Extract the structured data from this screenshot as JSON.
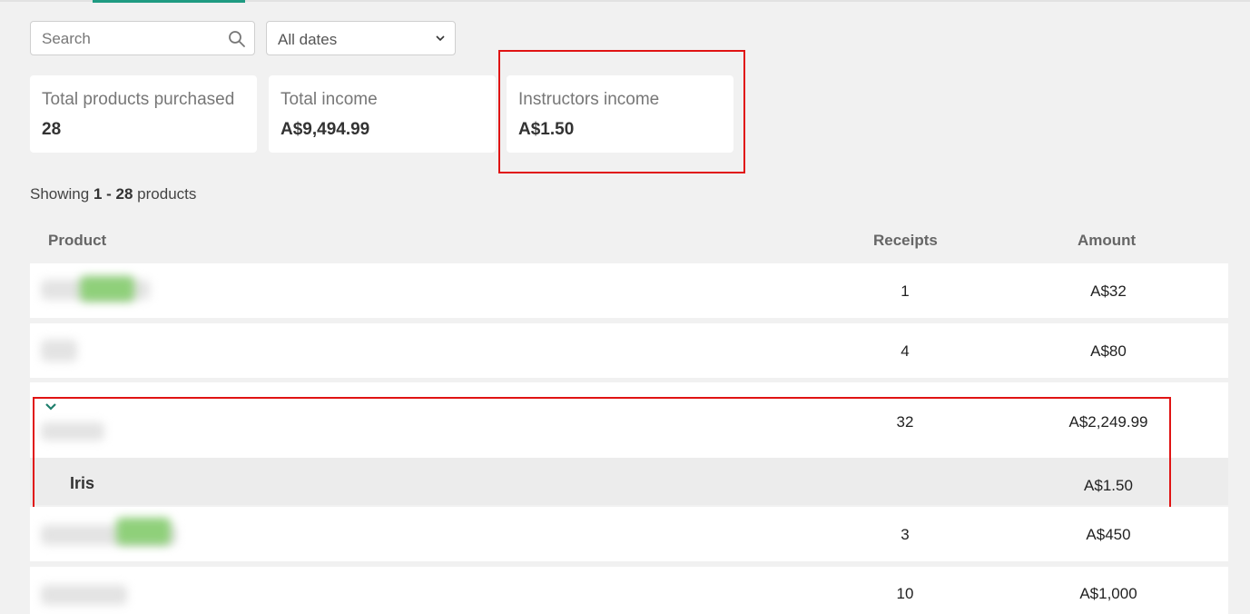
{
  "filters": {
    "search_placeholder": "Search",
    "date_filter": "All dates"
  },
  "summary": [
    {
      "label": "Total products purchased",
      "value": "28"
    },
    {
      "label": "Total income",
      "value": "A$9,494.99"
    },
    {
      "label": "Instructors income",
      "value": "A$1.50"
    }
  ],
  "showing": {
    "prefix": "Showing",
    "range": "1 - 28",
    "suffix": "products"
  },
  "table": {
    "columns": [
      "Product",
      "Receipts",
      "Amount"
    ],
    "rows": [
      {
        "receipts": "1",
        "amount": "A$32"
      },
      {
        "receipts": "4",
        "amount": "A$80"
      },
      {
        "receipts": "32",
        "amount": "A$2,249.99"
      },
      {
        "receipts": "3",
        "amount": "A$450"
      },
      {
        "receipts": "10",
        "amount": "A$1,000"
      }
    ],
    "expanded_subrow": {
      "name": "Iris",
      "amount": "A$1.50"
    }
  },
  "colors": {
    "accent": "#1f9b82",
    "highlight": "#e01414"
  }
}
